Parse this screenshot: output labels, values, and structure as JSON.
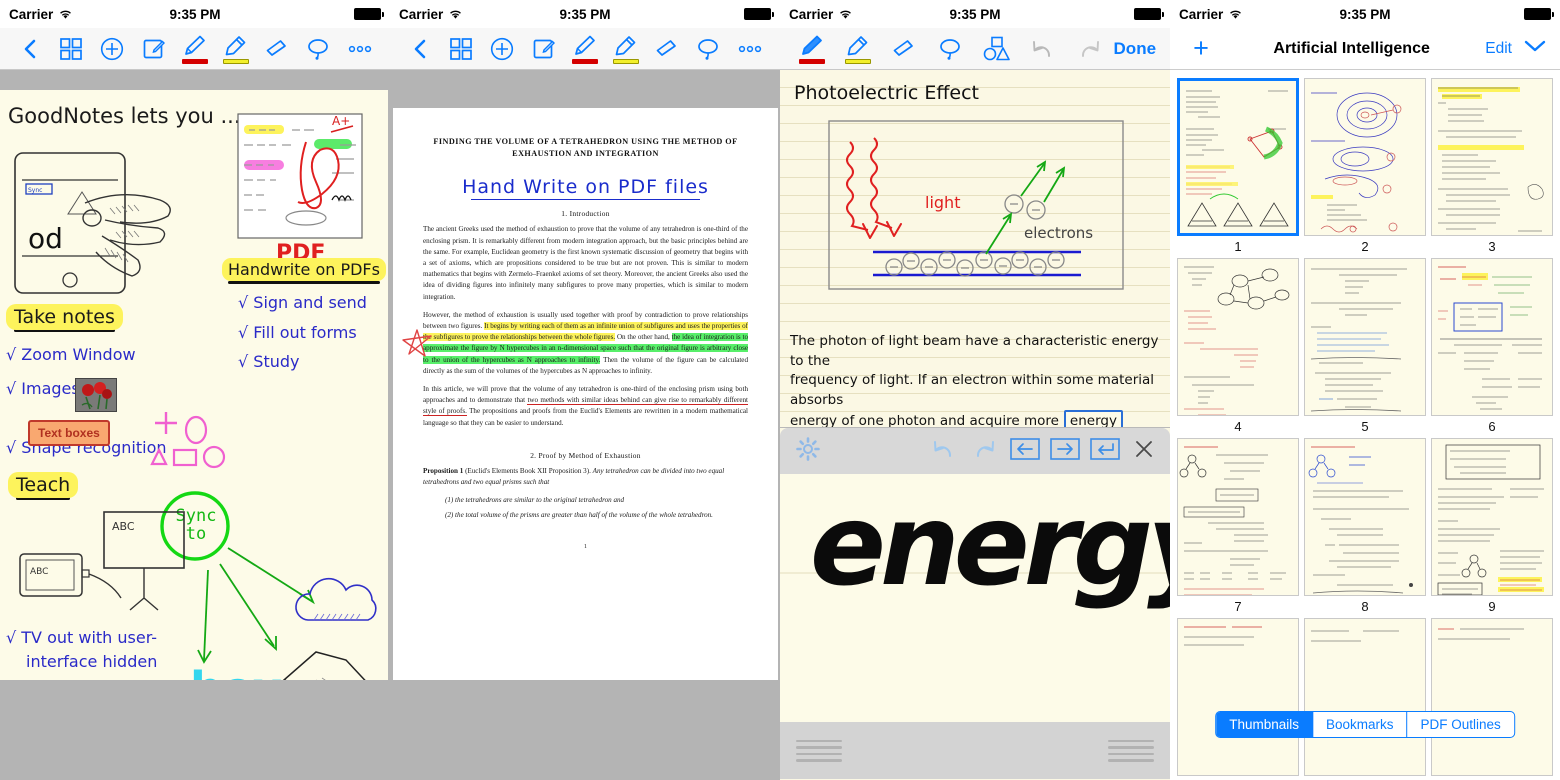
{
  "status_bar": {
    "carrier": "Carrier",
    "time": "9:35 PM",
    "wifi_icon": "wifi-icon",
    "battery_icon": "battery-full-icon"
  },
  "panel1": {
    "name": "goodnotes-notebook-editor",
    "toolbar": [
      {
        "name": "back-button",
        "icon": "chevron-left-icon"
      },
      {
        "name": "grid-view-button",
        "icon": "grid-icon"
      },
      {
        "name": "add-page-button",
        "icon": "plus-circle-icon"
      },
      {
        "name": "text-box-button",
        "icon": "compose-icon"
      },
      {
        "name": "pen-tool-button",
        "icon": "pen-icon",
        "swatch": "#d40000"
      },
      {
        "name": "highlighter-tool-button",
        "icon": "highlighter-icon",
        "swatch": "#f2ef2c"
      },
      {
        "name": "eraser-tool-button",
        "icon": "eraser-icon"
      },
      {
        "name": "lasso-tool-button",
        "icon": "lasso-icon"
      },
      {
        "name": "more-options-button",
        "icon": "ellipsis-icon"
      }
    ],
    "page": {
      "heading": "GoodNotes lets you ...",
      "badge_take_notes": "Take notes",
      "badge_handwrite": "Handwrite on PDFs",
      "badge_teach": "Teach",
      "pdf_label": "PDF",
      "grade_label": "A+",
      "sync_label_line1": "Sync",
      "sync_label_line2": "to",
      "box_label": "box",
      "device_letters": "od",
      "tv_label": "ABC",
      "screen_label": "ABC",
      "text_box_sample": "Text boxes",
      "left_items": [
        "√ Zoom Window",
        "√ Images",
        "√ Shape recognition"
      ],
      "left_items_tail": [
        "√ TV out with user-",
        "interface hidden"
      ],
      "right_items": [
        "√ Sign and send",
        "√ Fill out forms",
        "√ Study"
      ]
    }
  },
  "panel2": {
    "name": "goodnotes-pdf-annotation",
    "toolbar": [
      {
        "name": "back-button",
        "icon": "chevron-left-icon"
      },
      {
        "name": "grid-view-button",
        "icon": "grid-icon"
      },
      {
        "name": "add-page-button",
        "icon": "plus-circle-icon"
      },
      {
        "name": "text-box-button",
        "icon": "compose-icon"
      },
      {
        "name": "pen-tool-button",
        "icon": "pen-icon",
        "swatch": "#d40000"
      },
      {
        "name": "highlighter-tool-button",
        "icon": "highlighter-icon",
        "swatch": "#f2ef2c"
      },
      {
        "name": "eraser-tool-button",
        "icon": "eraser-icon"
      },
      {
        "name": "lasso-tool-button",
        "icon": "lasso-icon"
      },
      {
        "name": "more-options-button",
        "icon": "ellipsis-icon"
      }
    ],
    "document": {
      "title": "FINDING THE VOLUME OF A TETRAHEDRON USING THE METHOD OF EXHAUSTION AND INTEGRATION",
      "handwritten_note": "Hand Write on PDF files",
      "section1": "1. Introduction",
      "para1": "The ancient Greeks used the method of exhaustion to prove that the volume of any tetrahedron is one-third of the enclosing prism. It is remarkably different from modern integration approach, but the basic principles behind are the same. For example, Euclidean geometry is the first known systematic discussion of geometry that begins with a set of axioms, which are propositions considered to be true but are not proven. This is similar to modern mathematics that begins with Zermelo–Fraenkel axioms of set theory. Moreover, the ancient Greeks also used the idea of dividing figures into infinitely many subfigures to prove many properties, which is similar to modern integration.",
      "para2_pre": "However, the method of exhaustion is usually used together with proof by contradiction to prove relationships between two figures.",
      "para2_yellow": "It begins by writing each of them as an infinite union of subfigures and uses the properties of the subfigures to prove the relationships between the whole figures.",
      "para2_mid": "On the other hand,",
      "para2_green": "the idea of integration is to approximate the figure by N hypercubes in an n-dimensional space such that the original figure is arbitrary close to the union of the hypercubes as N approaches to infinity.",
      "para2_post": "Then the volume of the figure can be calculated directly as the sum of the volumes of the hypercubes as N approaches to infinity.",
      "para3_pre": "In this article, we will prove that the volume of any tetrahedron is one-third of the enclosing prism using both approaches and to demonstrate that",
      "para3_underline": "two methods with similar ideas behind can give rise to remarkably different style of proofs.",
      "para3_post": "The propositions and proofs from the Euclid's Elements are rewritten in a modern mathematical language so that they can be easier to understand.",
      "section2": "2. Proof by Method of Exhaustion",
      "prop_label": "Proposition 1",
      "prop_ref": "(Euclid's Elements Book XII Proposition 3).",
      "prop_text": "Any tetrahedron can be divided into two equal tetrahedrons and two equal prisms such that",
      "prop_item1": "(1) the tetrahedrons are similar to the original tetrahedron and",
      "prop_item2": "(2) the total volume of the prisms are greater than half of the volume of the whole tetrahedron.",
      "page_number": "1"
    }
  },
  "panel3": {
    "name": "goodnotes-zoom-window-editor",
    "toolbar": [
      {
        "name": "pen-tool-button",
        "icon": "pen-icon",
        "swatch": "#d40000"
      },
      {
        "name": "highlighter-tool-button",
        "icon": "highlighter-icon",
        "swatch": "#f2ef2c"
      },
      {
        "name": "eraser-tool-button",
        "icon": "eraser-icon"
      },
      {
        "name": "lasso-tool-button",
        "icon": "lasso-icon"
      },
      {
        "name": "shapes-tool-button",
        "icon": "shapes-icon"
      },
      {
        "name": "undo-button",
        "icon": "undo-icon"
      },
      {
        "name": "redo-button",
        "icon": "redo-icon"
      }
    ],
    "done_label": "Done",
    "page": {
      "title": "Photoelectric Effect",
      "diagram_light_label": "light",
      "diagram_electrons_label": "electrons",
      "body_line1": "The photon of light beam have a characteristic energy to the",
      "body_line2": "frequency of light. If an electron within some material absorbs",
      "body_line3": "energy of one photon and acquire more",
      "selected_word": "energy"
    },
    "zoom_window": {
      "toolbar": [
        {
          "name": "zoom-settings-button",
          "icon": "gear-icon"
        },
        {
          "name": "undo-button",
          "icon": "undo-icon"
        },
        {
          "name": "redo-button",
          "icon": "redo-icon"
        },
        {
          "name": "move-left-button",
          "icon": "arrow-left-box-icon"
        },
        {
          "name": "move-right-button",
          "icon": "arrow-right-box-icon"
        },
        {
          "name": "new-line-button",
          "icon": "return-box-icon"
        },
        {
          "name": "close-zoom-window-button",
          "icon": "close-icon"
        }
      ],
      "canvas_text": "energy"
    }
  },
  "panel4": {
    "name": "goodnotes-thumbnail-browser",
    "add_label": "+",
    "title": "Artificial Intelligence",
    "edit_label": "Edit",
    "chevron_icon": "chevron-down-icon",
    "thumbnails": [
      {
        "num": "1",
        "selected": true
      },
      {
        "num": "2",
        "selected": false
      },
      {
        "num": "3",
        "selected": false
      },
      {
        "num": "4",
        "selected": false
      },
      {
        "num": "5",
        "selected": false
      },
      {
        "num": "6",
        "selected": false
      },
      {
        "num": "7",
        "selected": false
      },
      {
        "num": "8",
        "selected": false
      },
      {
        "num": "9",
        "selected": false
      },
      {
        "num": "",
        "selected": false
      },
      {
        "num": "",
        "selected": false
      },
      {
        "num": "",
        "selected": false
      }
    ],
    "segments": [
      {
        "label": "Thumbnails",
        "active": true
      },
      {
        "label": "Bookmarks",
        "active": false
      },
      {
        "label": "PDF Outlines",
        "active": false
      }
    ]
  },
  "colors": {
    "accent": "#0a7cff",
    "pen_red": "#d40000",
    "highlight_yellow": "#fdf35c",
    "highlight_green": "#58ef6a",
    "page_cream": "#fdfbe8"
  }
}
